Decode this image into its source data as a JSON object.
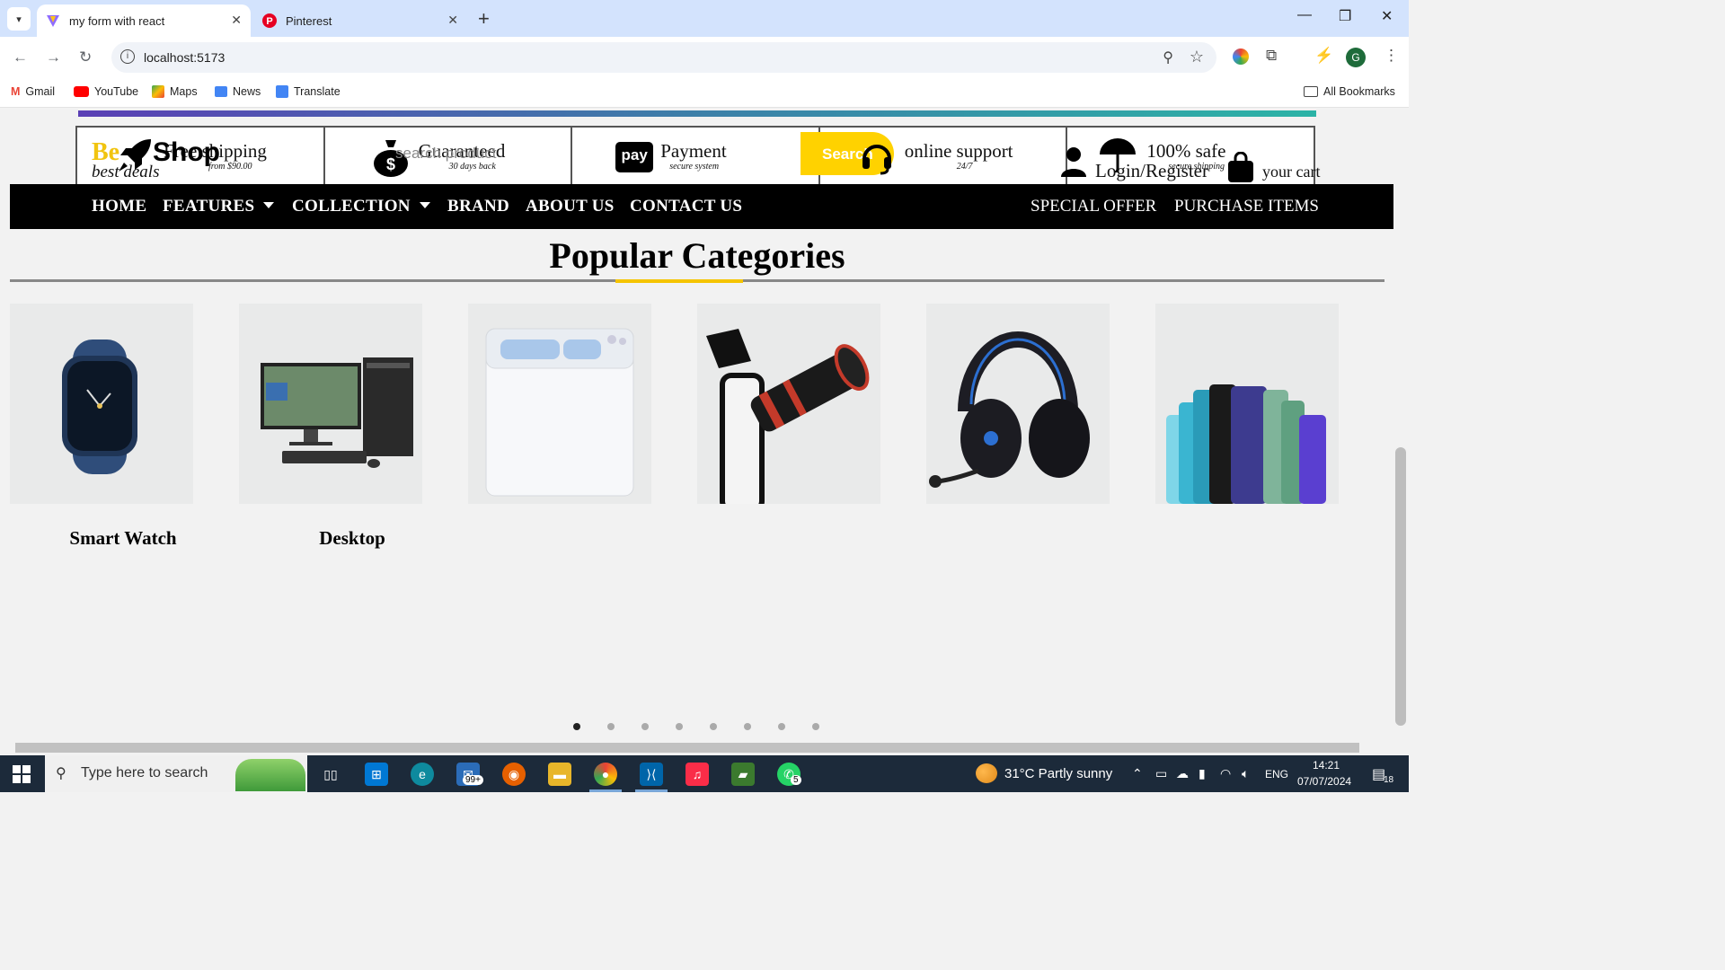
{
  "browser": {
    "tabs": [
      {
        "title": "my form with react",
        "active": true
      },
      {
        "title": "Pinterest",
        "active": false
      }
    ],
    "new_tab": "+",
    "url": "localhost:5173",
    "bookmarks": [
      "Gmail",
      "YouTube",
      "Maps",
      "News",
      "Translate"
    ],
    "all_bookmarks": "All Bookmarks",
    "profile_initial": "G"
  },
  "page": {
    "logo": {
      "best": "Be",
      "deals": "best deals",
      "shop": "Shop"
    },
    "search_placeholder": "search product",
    "search_button": "Search",
    "features": [
      {
        "title": "Free shipping",
        "sub": "from $90.00"
      },
      {
        "title": "Guaranteed",
        "sub": "30 days back"
      },
      {
        "title": "Payment",
        "sub": "secure system"
      },
      {
        "title": "online support",
        "sub": "24/7"
      },
      {
        "title": "100% safe",
        "sub": "secure shipping"
      }
    ],
    "pay_icon_text": "pay",
    "login": "Login/Register",
    "cart": "your cart",
    "nav": [
      {
        "label": "HOME",
        "dropdown": false
      },
      {
        "label": "FEATURES",
        "dropdown": true
      },
      {
        "label": "COLLECTION",
        "dropdown": true
      },
      {
        "label": "BRAND",
        "dropdown": false
      },
      {
        "label": "ABOUT US",
        "dropdown": false
      },
      {
        "label": "CONTACT US",
        "dropdown": false
      }
    ],
    "nav_right": [
      "SPECIAL OFFER",
      "PURCHASE ITEMS"
    ],
    "section_title": "Popular Categories",
    "categories": [
      {
        "label": "Smart Watch",
        "image": "smart-watch"
      },
      {
        "label": "Desktop",
        "image": "desktop-computer"
      },
      {
        "label": "",
        "image": "washing-machine"
      },
      {
        "label": "",
        "image": "phone-telescope-lens"
      },
      {
        "label": "",
        "image": "gaming-headset"
      },
      {
        "label": "",
        "image": "smartphones"
      }
    ],
    "carousel_dots": 8,
    "active_dot": 0,
    "colors": {
      "accent": "#ffd200",
      "navbar": "#000000"
    }
  },
  "taskbar": {
    "search_placeholder": "Type here to search",
    "mail_badge": "99+",
    "whatsapp_badge": "5",
    "weather": "31°C  Partly sunny",
    "lang": "ENG",
    "time": "14:21",
    "date": "07/07/2024",
    "notifications": "18"
  }
}
